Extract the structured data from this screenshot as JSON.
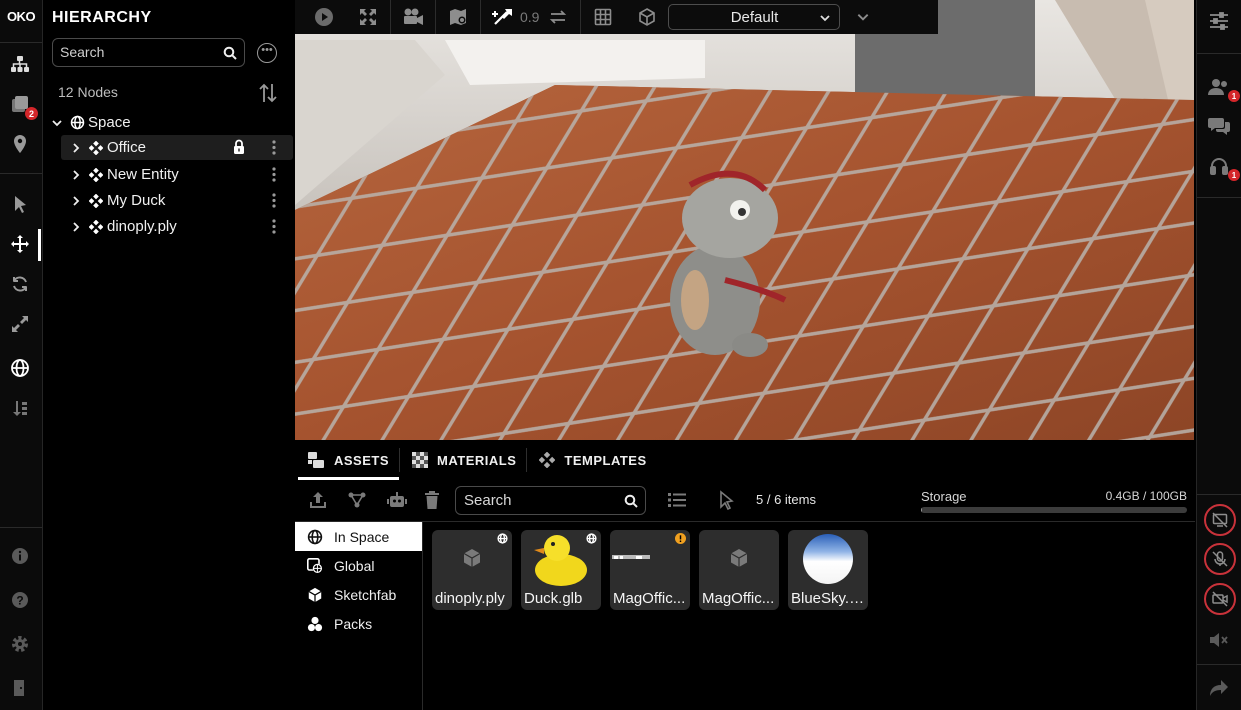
{
  "app": {
    "logo": "OKO"
  },
  "left_rail": {
    "items": [
      {
        "name": "hierarchy-icon"
      },
      {
        "name": "layers-icon",
        "badge": "2"
      },
      {
        "name": "map-pin-icon"
      },
      {
        "name": "pointer-icon"
      },
      {
        "name": "move-icon"
      },
      {
        "name": "rotate-icon"
      },
      {
        "name": "scale-icon"
      },
      {
        "name": "globe-icon"
      },
      {
        "name": "sort-icon"
      },
      {
        "name": "info-icon"
      },
      {
        "name": "help-icon"
      },
      {
        "name": "settings-icon"
      },
      {
        "name": "exit-icon"
      }
    ]
  },
  "hierarchy": {
    "title": "HIERARCHY",
    "search_placeholder": "Search",
    "node_count": "12 Nodes",
    "root": "Space",
    "nodes": [
      {
        "label": "Office",
        "locked": true,
        "selected": true
      },
      {
        "label": "New Entity"
      },
      {
        "label": "My Duck"
      },
      {
        "label": "dinoply.ply"
      }
    ]
  },
  "toolbar": {
    "snap_value": "0.9",
    "view_preset": "Default"
  },
  "assets": {
    "tabs": [
      {
        "label": "ASSETS",
        "active": true
      },
      {
        "label": "MATERIALS"
      },
      {
        "label": "TEMPLATES"
      }
    ],
    "search_placeholder": "Search",
    "items_count": "5 / 6 items",
    "storage_label": "Storage",
    "storage_value": "0.4GB / 100GB",
    "storage_fraction": 0.004,
    "scopes": [
      {
        "label": "In Space",
        "active": true
      },
      {
        "label": "Global"
      },
      {
        "label": "Sketchfab"
      },
      {
        "label": "Packs"
      }
    ],
    "cards": [
      {
        "name": "dinoply.ply"
      },
      {
        "name": "Duck.glb"
      },
      {
        "name": "MagOffic..."
      },
      {
        "name": "MagOffic..."
      },
      {
        "name": "BlueSky.gl..."
      }
    ]
  },
  "right_rail": {
    "users_badge": "1",
    "audio_badge": "1"
  },
  "colors": {
    "accent_red": "#d4262a",
    "warning": "#f0a020"
  }
}
